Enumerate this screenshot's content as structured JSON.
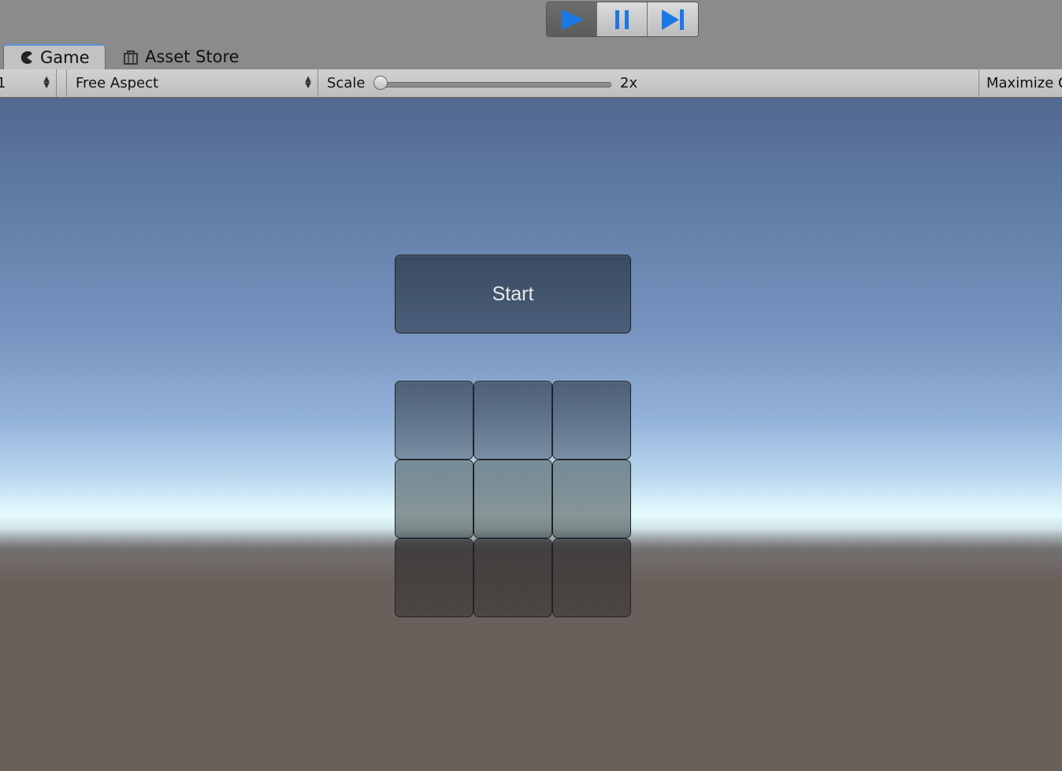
{
  "toolbar": {
    "play_icon": "play-icon",
    "pause_icon": "pause-icon",
    "step_icon": "step-icon",
    "accent_color": "#1a78e6",
    "play_state": "playing"
  },
  "tabs": [
    {
      "label": "Game",
      "icon": "pacman-icon",
      "active": true
    },
    {
      "label": "Asset Store",
      "icon": "shopping-bag-icon",
      "active": false
    }
  ],
  "game_controls": {
    "display_value": "1",
    "aspect_value": "Free Aspect",
    "scale_label": "Scale",
    "scale_value_label": "2x",
    "scale_level": 0.0,
    "maximize_label": "Maximize On Play"
  },
  "game_view": {
    "start_label": "Start",
    "grid": {
      "rows": 3,
      "columns": 3
    }
  }
}
